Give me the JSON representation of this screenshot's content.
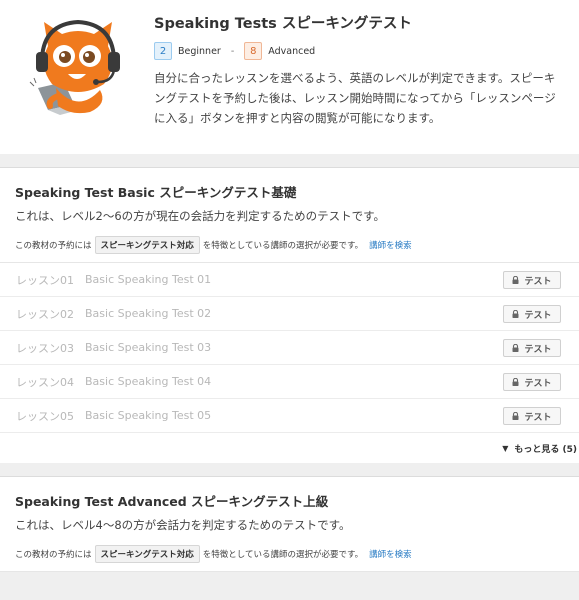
{
  "header": {
    "title": "Speaking Tests スピーキングテスト",
    "level_min_num": "2",
    "level_min_label": "Beginner",
    "level_sep": "-",
    "level_max_num": "8",
    "level_max_label": "Advanced",
    "description": "自分に合ったレッスンを選べるよう、英語のレベルが判定できます。スピーキングテストを予約した後は、レッスン開始時間になってから「レッスンページに入る」ボタンを押すと内容の閲覧が可能になります。",
    "mascot_icon": "mascot-headset-character-icon"
  },
  "sections": [
    {
      "title": "Speaking Test Basic スピーキングテスト基礎",
      "description": "これは、レベル2〜6の方が現在の会話力を判定するためのテストです。",
      "note_prefix": "この教材の予約には",
      "feature_badge": "スピーキングテスト対応",
      "note_suffix": "を特徴としている講師の選択が必要です。",
      "search_link": "講師を検索",
      "lessons": [
        {
          "num": "レッスン01",
          "name": "Basic Speaking Test 01",
          "button": "テスト"
        },
        {
          "num": "レッスン02",
          "name": "Basic Speaking Test 02",
          "button": "テスト"
        },
        {
          "num": "レッスン03",
          "name": "Basic Speaking Test 03",
          "button": "テスト"
        },
        {
          "num": "レッスン04",
          "name": "Basic Speaking Test 04",
          "button": "テスト"
        },
        {
          "num": "レッスン05",
          "name": "Basic Speaking Test 05",
          "button": "テスト"
        }
      ],
      "more_label": "もっと見る (5)"
    },
    {
      "title": "Speaking Test Advanced スピーキングテスト上級",
      "description": "これは、レベル4〜8の方が会話力を判定するためのテストです。",
      "note_prefix": "この教材の予約には",
      "feature_badge": "スピーキングテスト対応",
      "note_suffix": "を特徴としている講師の選択が必要です。",
      "search_link": "講師を検索"
    }
  ],
  "colors": {
    "accent_blue": "#2a7cc4",
    "mascot_orange": "#f07a1e",
    "disabled_text": "#b8b8b8"
  }
}
